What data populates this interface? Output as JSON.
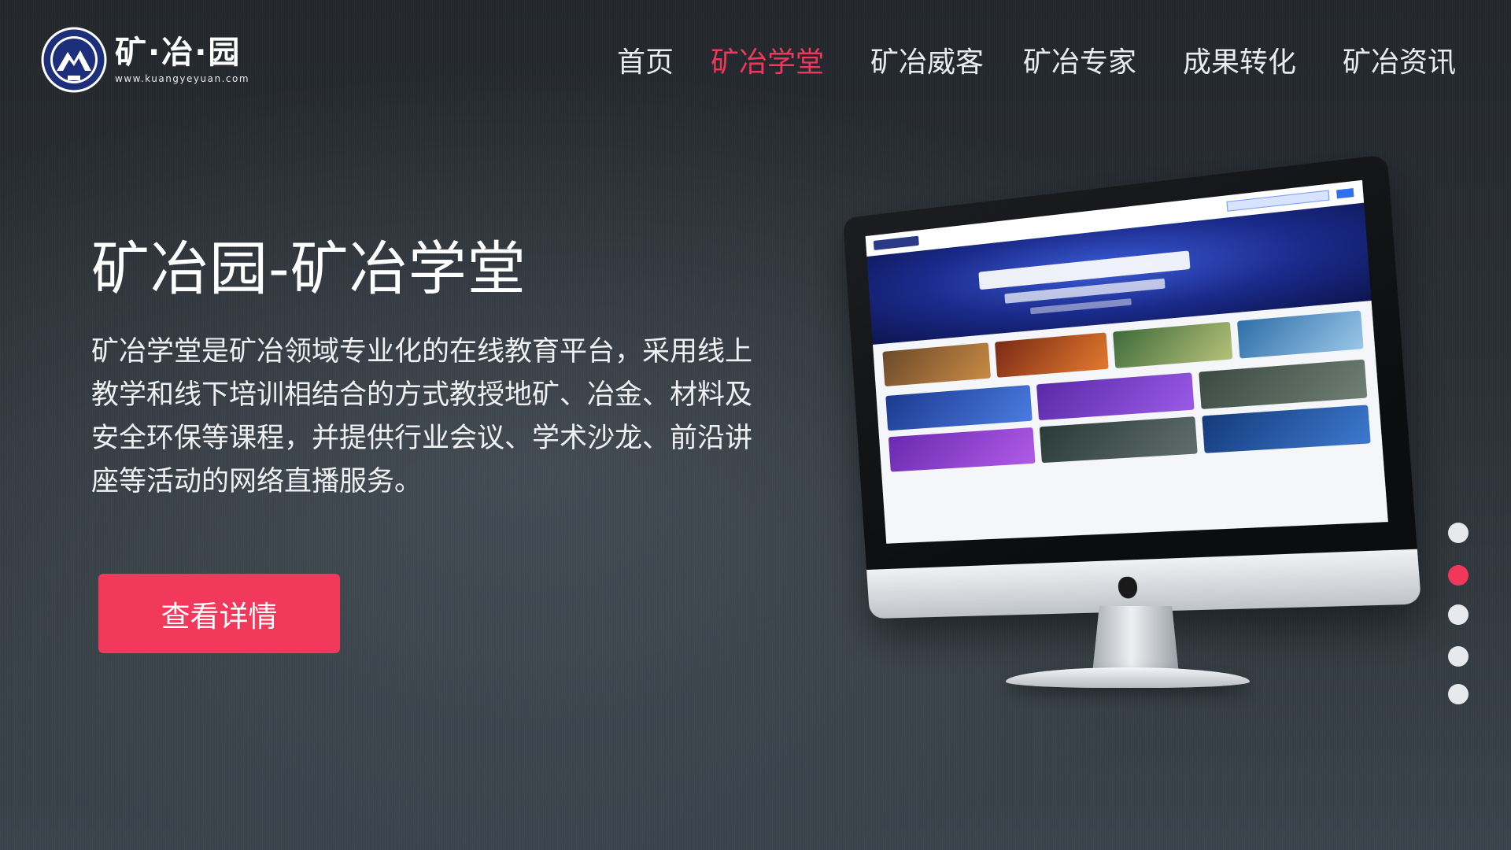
{
  "logo": {
    "name": "矿·冶·园",
    "url": "www.kuangyeyuan.com",
    "badge_icon": "mountain-emblem-icon"
  },
  "nav": {
    "items": [
      {
        "label": "首页",
        "active": false
      },
      {
        "label": "矿冶学堂",
        "active": true
      },
      {
        "label": "矿冶威客",
        "active": false
      },
      {
        "label": "矿冶专家",
        "active": false
      },
      {
        "label": "成果转化",
        "active": false
      },
      {
        "label": "矿冶资讯",
        "active": false
      }
    ]
  },
  "hero": {
    "title": "矿冶园-矿冶学堂",
    "description": "矿冶学堂是矿冶领域专业化的在线教育平台，采用线上教学和线下培训相结合的方式教授地矿、冶金、材料及安全环保等课程，并提供行业会议、学术沙龙、前沿讲座等活动的网络直播服务。",
    "cta_label": "查看详情"
  },
  "carousel": {
    "slide_count": 5,
    "active_index": 1
  },
  "colors": {
    "accent": "#f2385a",
    "background": "#2b3036",
    "text": "#ffffff"
  }
}
